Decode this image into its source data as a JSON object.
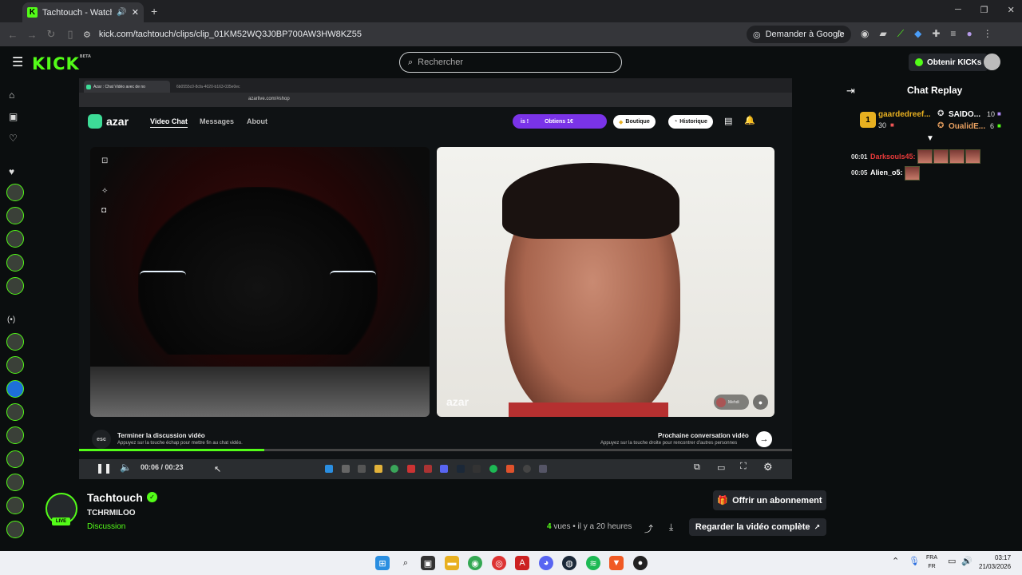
{
  "browser": {
    "tab_title": "Tachtouch - Watch clips on",
    "new_tab": "+",
    "url": "kick.com/tachtouch/clips/clip_01KM52WQ3J0BP700AW3HW8KZ55",
    "ask_google": "Demander à Google"
  },
  "kick": {
    "logo": "KICK",
    "logo_tag": "BETA",
    "search_placeholder": "Rechercher",
    "get_kicks": "Obtenir KICKs"
  },
  "inner_browser": {
    "tab1": "Azar : Chat Vidéo avec de no",
    "tab2": "6b0555c0-8cfa-4020-b163-035e0ec",
    "url": "azarlive.com/#shop"
  },
  "azar": {
    "logo": "azar",
    "nav": [
      "Video Chat",
      "Messages",
      "About"
    ],
    "promo_left": "is !",
    "promo": "Obtiens 1€",
    "boutique": "Boutique",
    "historique": "Historique",
    "watermark": "azar",
    "partner_name": "Mehdi",
    "esc": "esc",
    "end_title": "Terminer la discussion vidéo",
    "end_sub": "Appuyez sur la touche échap pour mettre fin au chat vidéo.",
    "next_title": "Prochaine conversation vidéo",
    "next_sub": "Appuyez sur la touche droite pour rencontrer d'autres personnes"
  },
  "player": {
    "time": "00:06 / 00:23",
    "progress": 0.26
  },
  "chat": {
    "title": "Chat Replay",
    "leaderboard": [
      {
        "rank": "1",
        "name": "gaardedreef...",
        "amount": "30"
      },
      {
        "name": "SAIDO...",
        "amount": "10"
      },
      {
        "name": "OualidE...",
        "amount": "6"
      }
    ],
    "messages": [
      {
        "time": "00:01",
        "user": "Darksouls45:",
        "emotes": 4,
        "color": "#e83a3a"
      },
      {
        "time": "00:05",
        "user": "Alien_o5:",
        "emotes": 1,
        "color": "#ffffff"
      }
    ]
  },
  "channel": {
    "name": "Tachtouch",
    "live_badge": "LIVE",
    "clip_title": "TCHRMILOO",
    "category": "Discussion",
    "subscribe": "Offrir un abonnement",
    "views_count": "4",
    "views_label": "vues",
    "age": "il y a 20 heures",
    "watch_full": "Regarder la vidéo complète"
  },
  "taskbar": {
    "lang1": "FRA",
    "lang2": "FR",
    "time": "03:17",
    "date": "21/03/2026"
  }
}
